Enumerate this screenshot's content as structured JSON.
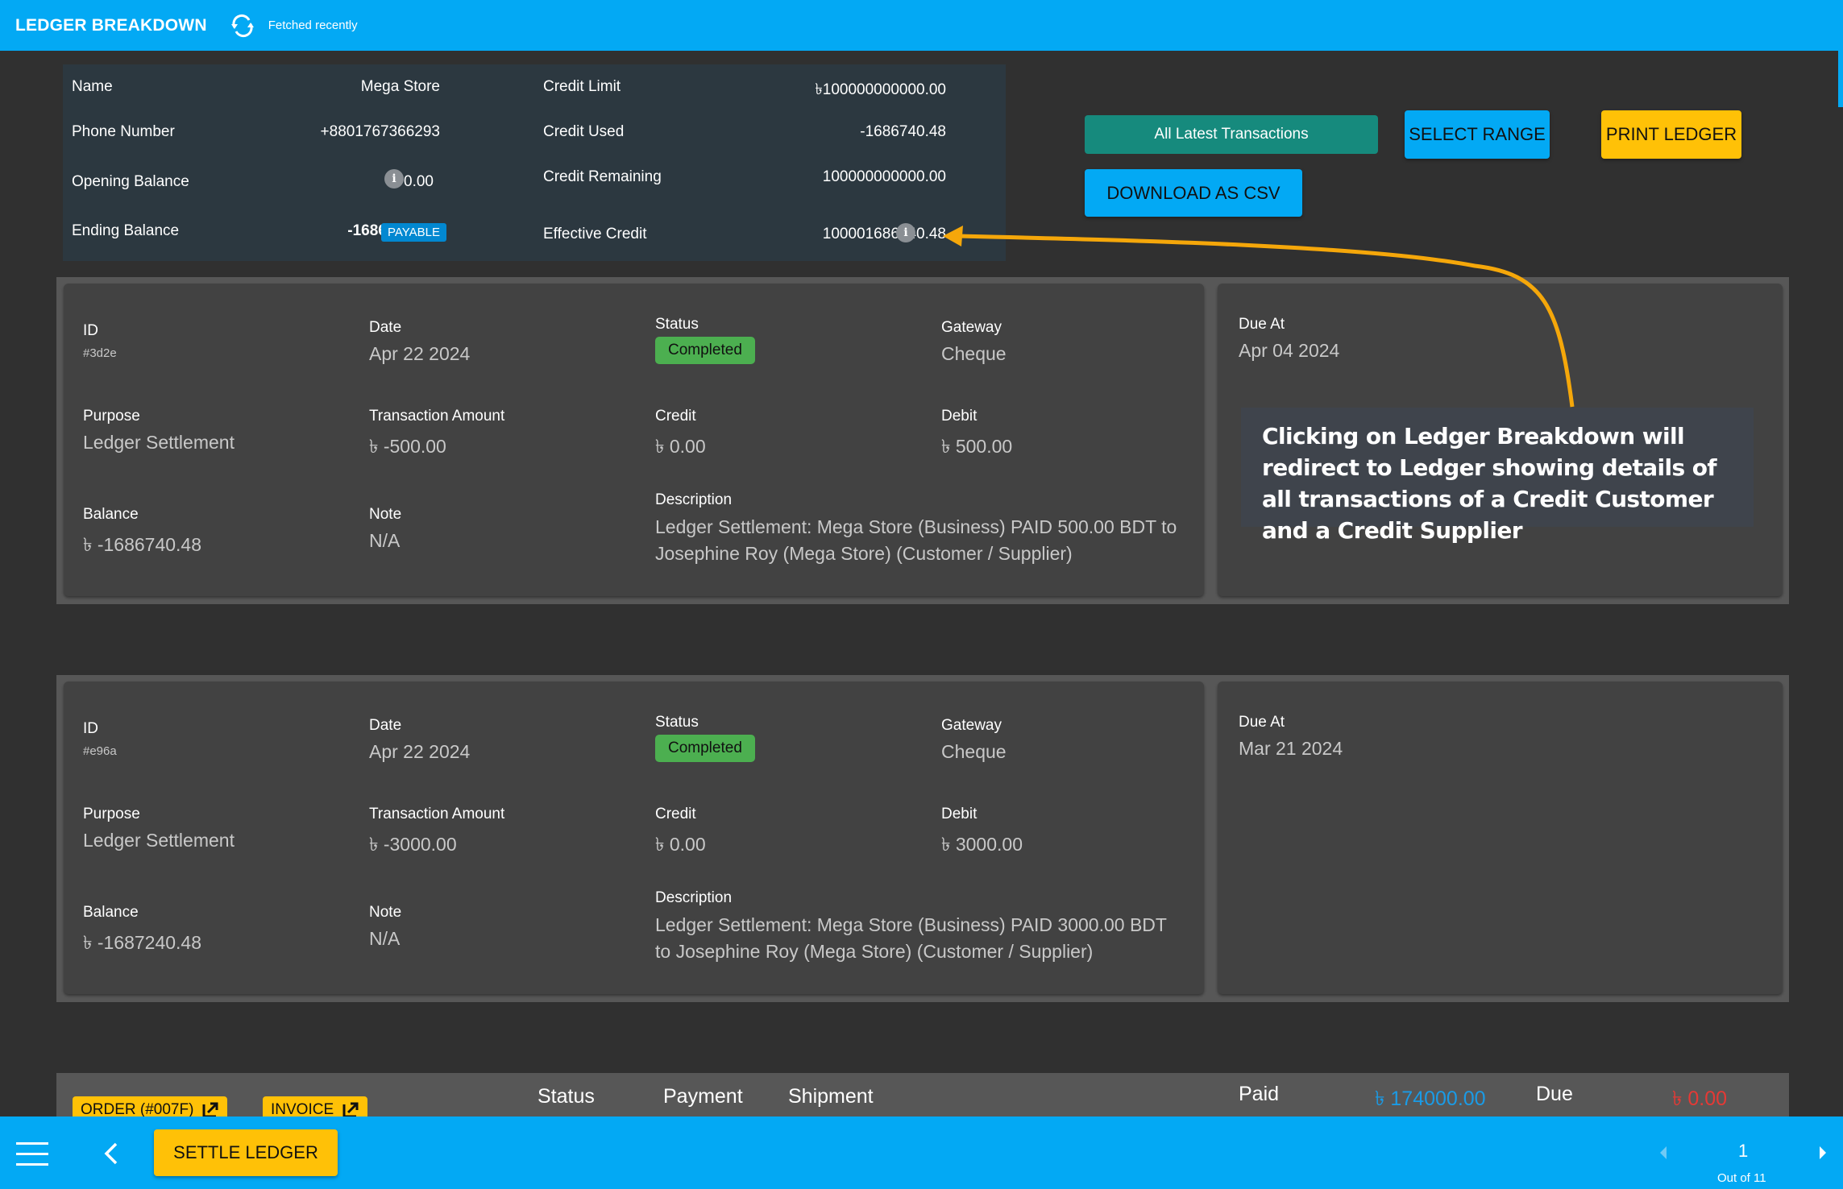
{
  "topbar": {
    "title": "LEDGER BREAKDOWN",
    "refresh_icon": "refresh-icon",
    "status": "Fetched recently"
  },
  "summary": {
    "left": [
      {
        "label": "Name",
        "value": "Mega Store"
      },
      {
        "label": "Phone Number",
        "value": "+8801767366293"
      },
      {
        "label": "Opening Balance",
        "value": "0.00"
      },
      {
        "label": "Ending Balance",
        "value": "-1686740.48",
        "badge": "PAYABLE"
      }
    ],
    "right": [
      {
        "label": "Credit Limit",
        "value": "100000000000.00",
        "currency": "৳"
      },
      {
        "label": "Credit Used",
        "value": "-1686740.48"
      },
      {
        "label": "Credit Remaining",
        "value": "100000000000.00"
      },
      {
        "label": "Effective Credit",
        "value": "100001686740.48"
      }
    ]
  },
  "actions": {
    "latest": "All Latest Transactions",
    "select_range": "SELECT RANGE",
    "print": "PRINT LEDGER",
    "csv": "DOWNLOAD AS CSV"
  },
  "labels": {
    "id": "ID",
    "date": "Date",
    "status": "Status",
    "gateway": "Gateway",
    "purpose": "Purpose",
    "amount": "Transaction Amount",
    "credit": "Credit",
    "debit": "Debit",
    "balance": "Balance",
    "note": "Note",
    "description": "Description",
    "due_at": "Due At"
  },
  "currency": "৳",
  "transactions": [
    {
      "id": "#3d2e",
      "date": "Apr 22 2024",
      "status": "Completed",
      "gateway": "Cheque",
      "purpose": "Ledger Settlement",
      "amount": "৳ -500.00",
      "credit": "৳ 0.00",
      "debit": "৳ 500.00",
      "balance": "৳ -1686740.48",
      "note": "N/A",
      "description": "Ledger Settlement: Mega Store (Business) PAID 500.00 BDT to Josephine Roy (Mega Store) (Customer / Supplier)",
      "due_at": "Apr 04 2024"
    },
    {
      "id": "#e96a",
      "date": "Apr 22 2024",
      "status": "Completed",
      "gateway": "Cheque",
      "purpose": "Ledger Settlement",
      "amount": "৳ -3000.00",
      "credit": "৳ 0.00",
      "debit": "৳ 3000.00",
      "balance": "৳ -1687240.48",
      "note": "N/A",
      "description": "Ledger Settlement: Mega Store (Business) PAID 3000.00 BDT to Josephine Roy (Mega Store) (Customer / Supplier)",
      "due_at": "Mar 21 2024"
    }
  ],
  "callout": "Clicking on Ledger Breakdown will redirect to Ledger showing details of all transactions of a Credit Customer and a Credit Supplier",
  "order": {
    "order_btn": "ORDER (#007F)",
    "invoice_btn": "INVOICE",
    "status": "Status",
    "payment": "Payment",
    "shipment": "Shipment",
    "paid_label": "Paid",
    "paid_value": "৳ 174000.00",
    "due_label": "Due",
    "due_value": "৳ 0.00"
  },
  "bottombar": {
    "settle": "SETTLE LEDGER",
    "page": "1",
    "page_of": "Out of 11"
  },
  "colors": {
    "primary": "#03a9f4",
    "accent": "#ffc107",
    "success": "#4caf50",
    "teal": "#168a7d",
    "paid": "#1a9be6",
    "due": "#e53935"
  }
}
